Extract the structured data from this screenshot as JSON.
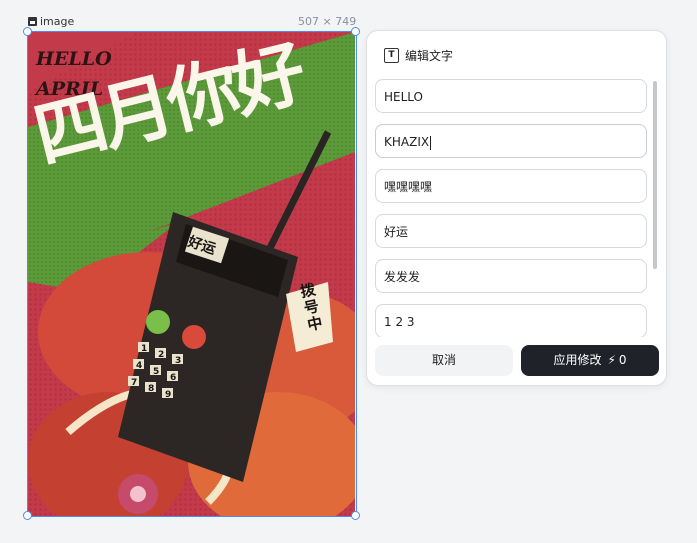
{
  "canvas": {
    "image_label": "image",
    "image_dimensions": "507 × 749"
  },
  "poster": {
    "text_hello": "HELLO",
    "text_april": "APRIL",
    "headline": "四月你好",
    "phone_screen": "好运",
    "tag": "拨号中",
    "keypad": [
      "1",
      "2",
      "3",
      "4",
      "5",
      "6",
      "7",
      "8",
      "9"
    ]
  },
  "editor": {
    "title": "编辑文字",
    "fields": [
      "HELLO",
      "KHAZIX",
      "嘿嘿嘿嘿",
      "好运",
      "发发发",
      "1 2 3"
    ],
    "cancel_label": "取消",
    "apply_label": "应用修改",
    "apply_cost": "0"
  },
  "colors": {
    "accent": "#4a8df0",
    "poster_bg": "#c33a4a",
    "poster_green": "#5c9a3a",
    "apply_bg": "#1f2329"
  }
}
